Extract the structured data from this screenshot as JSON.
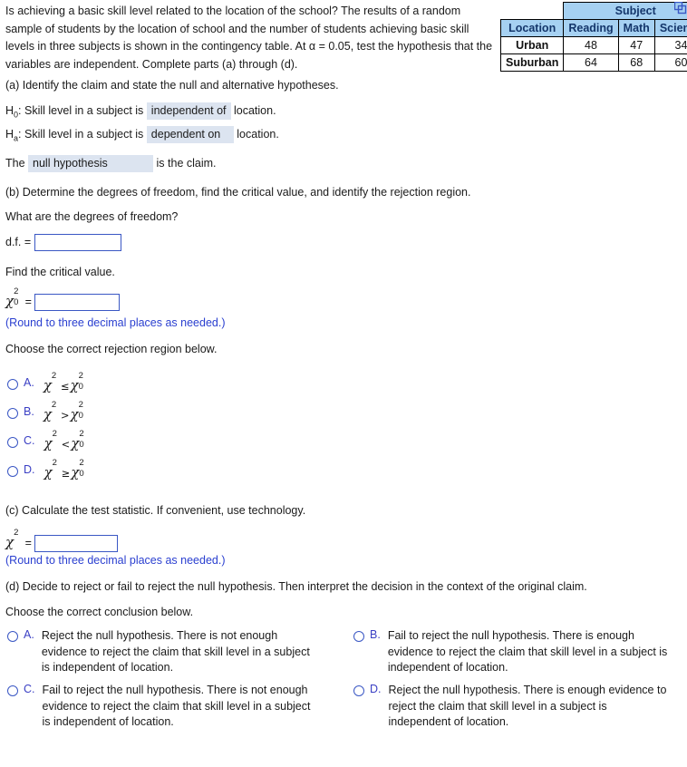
{
  "intro": {
    "text": "Is achieving a basic skill level related to the location of the school? The results of a random sample of students by the location of school and the number of students achieving basic skill levels in three subjects is shown in the contingency table. At α = 0.05, test the hypothesis that the variables are independent. Complete parts (a) through (d)."
  },
  "table": {
    "group_header": "Subject",
    "corner_label": "Location",
    "columns": [
      "Reading",
      "Math",
      "Science"
    ],
    "rows": [
      {
        "label": "Urban",
        "values": [
          "48",
          "47",
          "34"
        ]
      },
      {
        "label": "Suburban",
        "values": [
          "64",
          "68",
          "60"
        ]
      }
    ]
  },
  "part_a": {
    "prompt": "(a) Identify the claim and state the null and alternative hypotheses.",
    "h0_label": "H",
    "h0_sub": "0",
    "h0_pre": ": Skill level in a subject is",
    "h0_choice": "independent of",
    "h0_post": "location.",
    "ha_label": "H",
    "ha_sub": "a",
    "ha_pre": ": Skill level in a subject is",
    "ha_choice": "dependent on",
    "ha_post": "location.",
    "claim_pre": "The",
    "claim_choice": "null hypothesis",
    "claim_post": "is the claim."
  },
  "part_b": {
    "prompt": "(b) Determine the degrees of freedom, find the critical value, and identify the rejection region.",
    "df_question": "What are the degrees of freedom?",
    "df_label": "d.f. =",
    "df_value": "",
    "critical_prompt": "Find the critical value.",
    "critical_symbol": "χ",
    "critical_sup": "2",
    "critical_sub": "0",
    "critical_eq": "=",
    "critical_value": "",
    "round_hint": "(Round to three decimal places as needed.)",
    "region_prompt": "Choose the correct rejection region below.",
    "options": [
      {
        "letter": "A.",
        "lhs": "χ",
        "lhs_sup": "2",
        "rel": "≤",
        "rhs": "χ",
        "rhs_sup": "2",
        "rhs_sub": "0"
      },
      {
        "letter": "B.",
        "lhs": "χ",
        "lhs_sup": "2",
        "rel": ">",
        "rhs": "χ",
        "rhs_sup": "2",
        "rhs_sub": "0"
      },
      {
        "letter": "C.",
        "lhs": "χ",
        "lhs_sup": "2",
        "rel": "<",
        "rhs": "χ",
        "rhs_sup": "2",
        "rhs_sub": "0"
      },
      {
        "letter": "D.",
        "lhs": "χ",
        "lhs_sup": "2",
        "rel": "≥",
        "rhs": "χ",
        "rhs_sup": "2",
        "rhs_sub": "0"
      }
    ]
  },
  "part_c": {
    "prompt": "(c) Calculate the test statistic. If convenient, use technology.",
    "symbol": "χ",
    "sup": "2",
    "eq": "=",
    "value": "",
    "round_hint": "(Round to three decimal places as needed.)"
  },
  "part_d": {
    "prompt": "(d) Decide to reject or fail to reject the null hypothesis. Then interpret the decision in the context of the original claim.",
    "choose_prompt": "Choose the correct conclusion below.",
    "options": [
      {
        "letter": "A.",
        "text": "Reject the null hypothesis. There is not enough evidence to reject the claim that skill level in a subject is independent of location."
      },
      {
        "letter": "B.",
        "text": "Fail to reject the null hypothesis. There is enough evidence to reject the claim that skill level in a subject is independent of location."
      },
      {
        "letter": "C.",
        "text": "Fail to reject the null hypothesis. There is not enough evidence to reject the claim that skill level in a subject is independent of location."
      },
      {
        "letter": "D.",
        "text": "Reject the null hypothesis. There is enough evidence to reject the claim that skill level in a subject is independent of location."
      }
    ]
  }
}
